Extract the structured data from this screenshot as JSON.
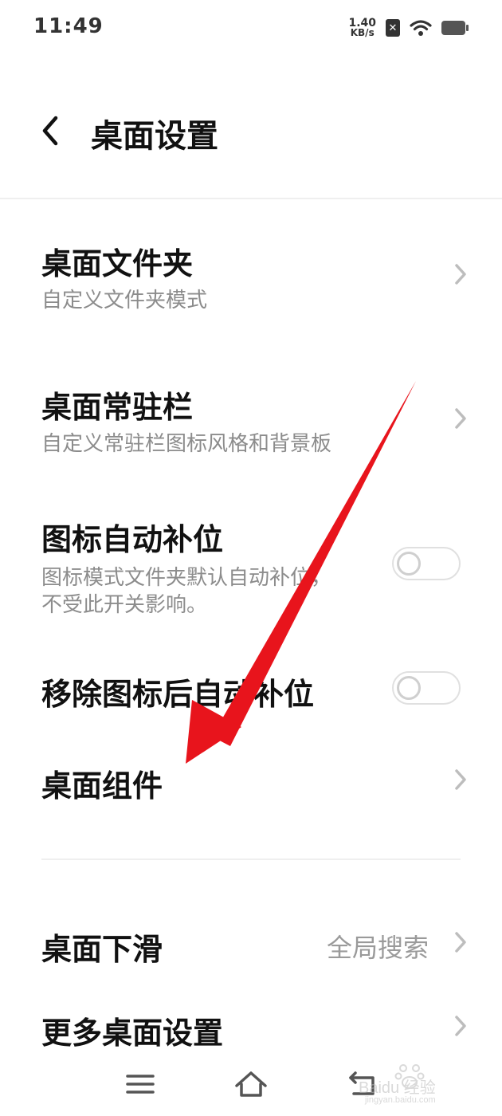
{
  "status_bar": {
    "time": "11:49",
    "net_speed_value": "1.40",
    "net_speed_unit": "KB/s",
    "sim_icon": "sim-off-icon",
    "wifi_icon": "wifi-icon",
    "battery_icon": "battery-icon"
  },
  "header": {
    "back_icon": "chevron-left-icon",
    "title": "桌面设置"
  },
  "settings": {
    "folder": {
      "title": "桌面文件夹",
      "subtitle": "自定义文件夹模式"
    },
    "dock": {
      "title": "桌面常驻栏",
      "subtitle": "自定义常驻栏图标风格和背景板"
    },
    "auto_fill": {
      "title": "图标自动补位",
      "subtitle_line1": "图标模式文件夹默认自动补位，",
      "subtitle_line2": "不受此开关影响。",
      "enabled": false
    },
    "auto_fill_after_remove": {
      "title": "移除图标后自动补位",
      "enabled": false
    },
    "widgets": {
      "title": "桌面组件"
    },
    "swipe_down": {
      "title": "桌面下滑",
      "value": "全局搜索"
    },
    "more": {
      "title": "更多桌面设置"
    }
  },
  "nav_bar": {
    "menu_icon": "menu-icon",
    "home_icon": "home-icon",
    "back_icon": "back-icon"
  },
  "watermark": {
    "text": "Baidu 经验",
    "url_text": "jingyan.baidu.com"
  },
  "colors": {
    "annotation_arrow": "#e8141c",
    "secondary_text": "#8c8c8c",
    "divider": "#efefef"
  }
}
